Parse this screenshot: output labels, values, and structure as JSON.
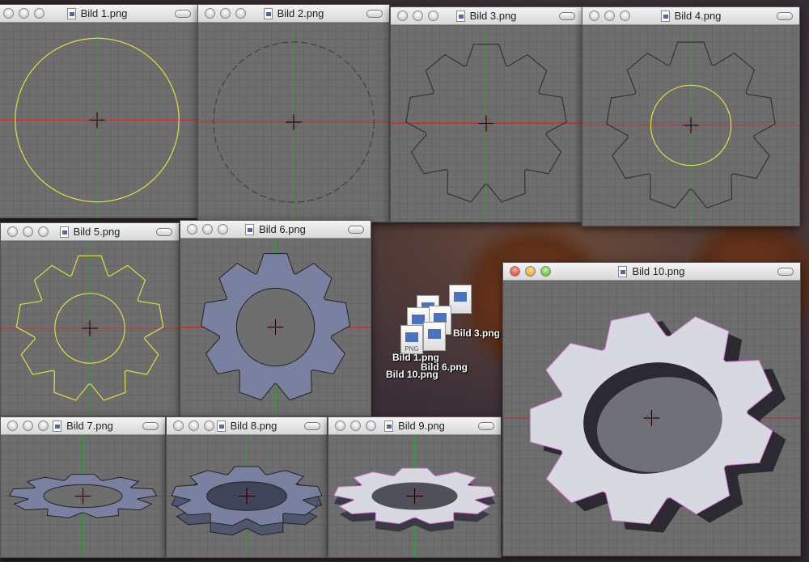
{
  "windows": [
    {
      "title": "Bild 1.png"
    },
    {
      "title": "Bild 2.png"
    },
    {
      "title": "Bild 3.png"
    },
    {
      "title": "Bild 4.png"
    },
    {
      "title": "Bild 5.png"
    },
    {
      "title": "Bild 6.png"
    },
    {
      "title": "Bild 7.png"
    },
    {
      "title": "Bild 8.png"
    },
    {
      "title": "Bild 9.png"
    },
    {
      "title": "Bild 10.png"
    }
  ],
  "desktop_icons": [
    {
      "label": "Bild 10.png"
    },
    {
      "label": "Bild 6.png"
    },
    {
      "label": "Bild 1.png"
    },
    {
      "label": "Bild 3.png"
    }
  ],
  "icon_badge": "PNG",
  "colors": {
    "viewport": "#6e6e6e",
    "x_axis": "#c03030",
    "y_axis": "#30a030",
    "vertex": "#e0e040",
    "mesh_fill": "#7a80a0",
    "solid_fill": "#d8d8e0"
  }
}
